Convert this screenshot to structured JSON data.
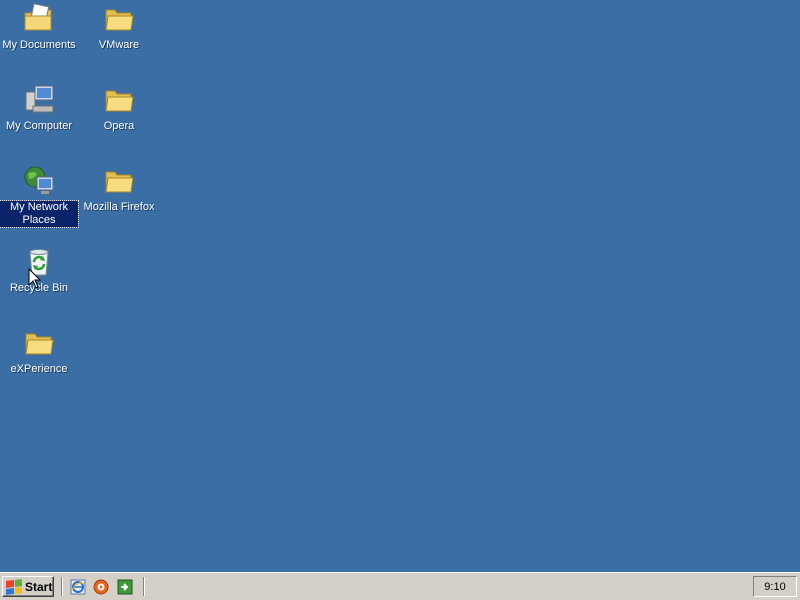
{
  "desktop": {
    "icons": [
      {
        "label": "My Documents",
        "icon": "my-documents-icon"
      },
      {
        "label": "VMware",
        "icon": "folder-icon"
      },
      {
        "label": "My Computer",
        "icon": "computer-icon"
      },
      {
        "label": "Opera",
        "icon": "folder-icon"
      },
      {
        "label": "My Network Places",
        "icon": "network-places-icon",
        "selected": true
      },
      {
        "label": "Mozilla Firefox",
        "icon": "folder-icon"
      },
      {
        "label": "Recycle Bin",
        "icon": "recycle-bin-icon"
      },
      {
        "label": "eXPerience",
        "icon": "folder-icon"
      }
    ]
  },
  "taskbar": {
    "start_label": "Start",
    "quick_launch": [
      {
        "icon": "internet-explorer-icon"
      },
      {
        "icon": "media-player-icon"
      },
      {
        "icon": "show-desktop-icon"
      }
    ],
    "clock": "9:10"
  },
  "colors": {
    "desktop_background": "#3a6ea5",
    "taskbar": "#d4d0c8",
    "selection": "#0a246a"
  }
}
